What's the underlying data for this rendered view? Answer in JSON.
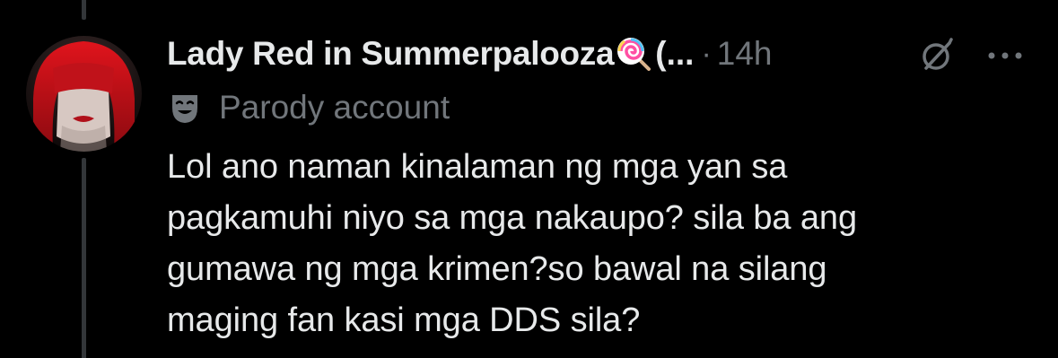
{
  "post": {
    "display_name": "Lady Red in Summerpalooza",
    "name_emoji": "lollipop-emoji",
    "name_truncated": "(...",
    "separator": "·",
    "timestamp": "14h",
    "account_label_icon": "theater-mask-icon",
    "account_label": "Parody account",
    "text_lines": [
      "Lol ano naman kinalaman ng mga yan sa",
      "pagkamuhi niyo sa mga nakaupo? sila ba ang",
      "gumawa ng mga krimen?so bawal na silang",
      "maging fan kasi mga DDS sila?"
    ]
  },
  "colors": {
    "background": "#000000",
    "primary_text": "#e7e9ea",
    "secondary_text": "#71767b",
    "thread_line": "#333639"
  }
}
